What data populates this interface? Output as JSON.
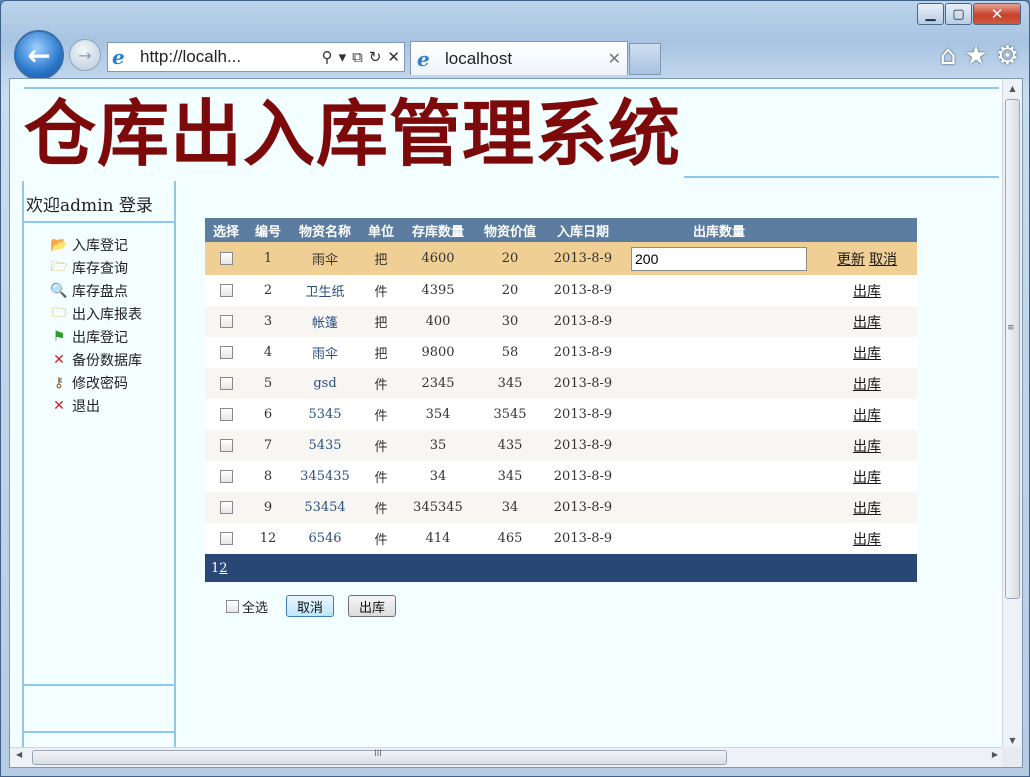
{
  "browser": {
    "address": "http://localh...",
    "tab_title": "localhost"
  },
  "page": {
    "title": "仓库出入库管理系统",
    "welcome": "欢迎admin 登录",
    "menu": [
      {
        "label": "入库登记",
        "icon": "folder-arrow-icon"
      },
      {
        "label": "库存查询",
        "icon": "folder-open-icon"
      },
      {
        "label": "库存盘点",
        "icon": "magnifier-icon"
      },
      {
        "label": "出入库报表",
        "icon": "report-folder-icon"
      },
      {
        "label": "出库登记",
        "icon": "green-flag-icon"
      },
      {
        "label": "备份数据库",
        "icon": "red-x-icon"
      },
      {
        "label": "修改密码",
        "icon": "key-icon"
      },
      {
        "label": "退出",
        "icon": "red-x-icon"
      }
    ]
  },
  "grid": {
    "headers": [
      "选择",
      "编号",
      "物资名称",
      "单位",
      "存库数量",
      "物资价值",
      "入库日期",
      "出库数量"
    ],
    "edit_row": {
      "id": "1",
      "name": "雨伞",
      "unit": "把",
      "qty": "4600",
      "value": "20",
      "date": "2013-8-9",
      "out_qty": "200",
      "update_label": "更新",
      "cancel_label": "取消"
    },
    "rows": [
      {
        "id": "2",
        "name": "卫生纸",
        "unit": "件",
        "qty": "4395",
        "value": "20",
        "date": "2013-8-9",
        "action": "出库"
      },
      {
        "id": "3",
        "name": "帐篷",
        "unit": "把",
        "qty": "400",
        "value": "30",
        "date": "2013-8-9",
        "action": "出库"
      },
      {
        "id": "4",
        "name": "雨伞",
        "unit": "把",
        "qty": "9800",
        "value": "58",
        "date": "2013-8-9",
        "action": "出库"
      },
      {
        "id": "5",
        "name": "gsd",
        "unit": "件",
        "qty": "2345",
        "value": "345",
        "date": "2013-8-9",
        "action": "出库"
      },
      {
        "id": "6",
        "name": "5345",
        "unit": "件",
        "qty": "354",
        "value": "3545",
        "date": "2013-8-9",
        "action": "出库"
      },
      {
        "id": "7",
        "name": "5435",
        "unit": "件",
        "qty": "35",
        "value": "435",
        "date": "2013-8-9",
        "action": "出库"
      },
      {
        "id": "8",
        "name": "345435",
        "unit": "件",
        "qty": "34",
        "value": "345",
        "date": "2013-8-9",
        "action": "出库"
      },
      {
        "id": "9",
        "name": "53454",
        "unit": "件",
        "qty": "345345",
        "value": "34",
        "date": "2013-8-9",
        "action": "出库"
      },
      {
        "id": "12",
        "name": "6546",
        "unit": "件",
        "qty": "414",
        "value": "465",
        "date": "2013-8-9",
        "action": "出库"
      }
    ],
    "pager": {
      "current": "1",
      "next": "2"
    }
  },
  "footer": {
    "select_all": "全选",
    "cancel_button": "取消",
    "out_button": "出库"
  }
}
